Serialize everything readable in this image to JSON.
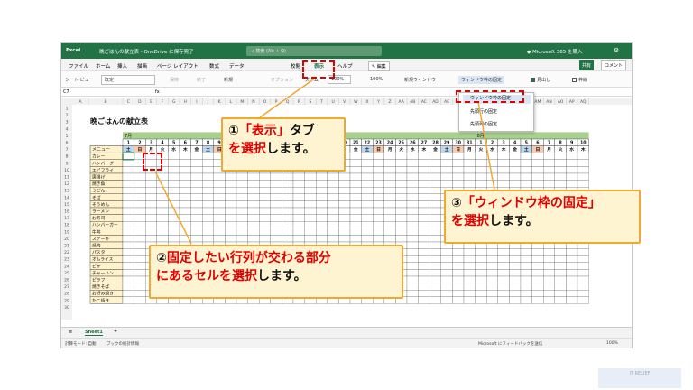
{
  "titlebar": {
    "app": "Excel",
    "doc": "晩ごはんの献立表 - OneDrive に保存完了",
    "search": "検索 (Alt + Q)",
    "ms365": "Microsoft 365 を購入"
  },
  "tabs": [
    "ファイル",
    "ホーム",
    "挿入",
    "描画",
    "ページ レイアウト",
    "数式",
    "データ",
    "校閲",
    "表示",
    "ヘルプ"
  ],
  "edit_button": "編集",
  "share_button": "共有",
  "comment_button": "コメント",
  "ribbon": {
    "sheet_view": "シート ビュー",
    "sheet_view_value": "既定",
    "keep": "保持",
    "exit": "終了",
    "new": "新規",
    "options": "オプション",
    "zoom": "ズーム",
    "zoom_value": "100%",
    "zoom_100": "100%",
    "new_window": "新規ウィンドウ",
    "freeze_panes": "ウィンドウ枠の固定",
    "headings": "見出し",
    "gridlines": "枠線"
  },
  "formula": {
    "namebox": "C7",
    "fx": "fx"
  },
  "dropdown": {
    "items": [
      "ウィンドウ枠の固定",
      "先頭行の固定",
      "先頭列の固定"
    ]
  },
  "columns": [
    "A",
    "B",
    "C",
    "D",
    "E",
    "F",
    "G",
    "H",
    "I",
    "J",
    "K",
    "L",
    "M",
    "N",
    "O",
    "P",
    "Q",
    "R",
    "S",
    "T",
    "U",
    "V",
    "W",
    "X",
    "Y",
    "Z",
    "AA",
    "AB",
    "AC",
    "AD",
    "AE",
    "AF",
    "AG",
    "AH",
    "AI",
    "AJ",
    "AK",
    "AL",
    "AM",
    "AN",
    "AO",
    "AP",
    "AQ"
  ],
  "sheet_title": "晩ごはんの献立表",
  "month1": "7月",
  "month2": "8月",
  "days1": [
    "1",
    "2",
    "3",
    "4",
    "5",
    "6",
    "7",
    "8",
    "9",
    "10",
    "11",
    "12",
    "13",
    "14",
    "15",
    "16",
    "17",
    "18",
    "19",
    "20",
    "21",
    "22",
    "23",
    "24",
    "25",
    "26",
    "27",
    "28",
    "29",
    "30",
    "31"
  ],
  "days2": [
    "1",
    "2",
    "3",
    "4",
    "5",
    "6",
    "7",
    "8",
    "9",
    "10"
  ],
  "weekdays1": [
    "土",
    "日",
    "月",
    "火",
    "水",
    "木",
    "金",
    "土",
    "日",
    "月",
    "火",
    "水",
    "木",
    "金",
    "土",
    "日",
    "月",
    "火",
    "水",
    "木",
    "金",
    "土",
    "日",
    "月",
    "火",
    "水",
    "木",
    "金",
    "土",
    "日",
    "月"
  ],
  "weekdays2": [
    "火",
    "水",
    "木",
    "金",
    "土",
    "日",
    "月",
    "火",
    "水",
    "木"
  ],
  "menu_header": "メニュー",
  "menu": [
    "カレー",
    "ハンバーグ",
    "エビフライ",
    "唐揚げ",
    "焼き魚",
    "うどん",
    "そば",
    "そうめん",
    "ラーメン",
    "お寿司",
    "ハンバーガー",
    "牛丼",
    "ステーキ",
    "焼肉",
    "パスタ",
    "オムライス",
    "ピザ",
    "チャーハン",
    "ピラフ",
    "焼きそば",
    "お好み焼き",
    "たこ焼き"
  ],
  "sheet_tab": "Sheet1",
  "status": {
    "mode": "計算モード: 自動",
    "stats": "ブックの統計情報",
    "feedback": "Microsoft にフィードバックを送信",
    "zoom": "100%"
  },
  "callouts": {
    "c1_num": "①",
    "c1_a": "「表示」",
    "c1_b": "タブ",
    "c1_c": "を選択",
    "c1_d": "します。",
    "c2_num": "②",
    "c2_a": "固定したい行列が交わる部分",
    "c2_b": "にあるセルを選択",
    "c2_c": "します。",
    "c3_num": "③",
    "c3_a": "「ウィンドウ枠の固定」",
    "c3_b": "を選択",
    "c3_c": "します。"
  },
  "watermark": "IT RELIEF"
}
